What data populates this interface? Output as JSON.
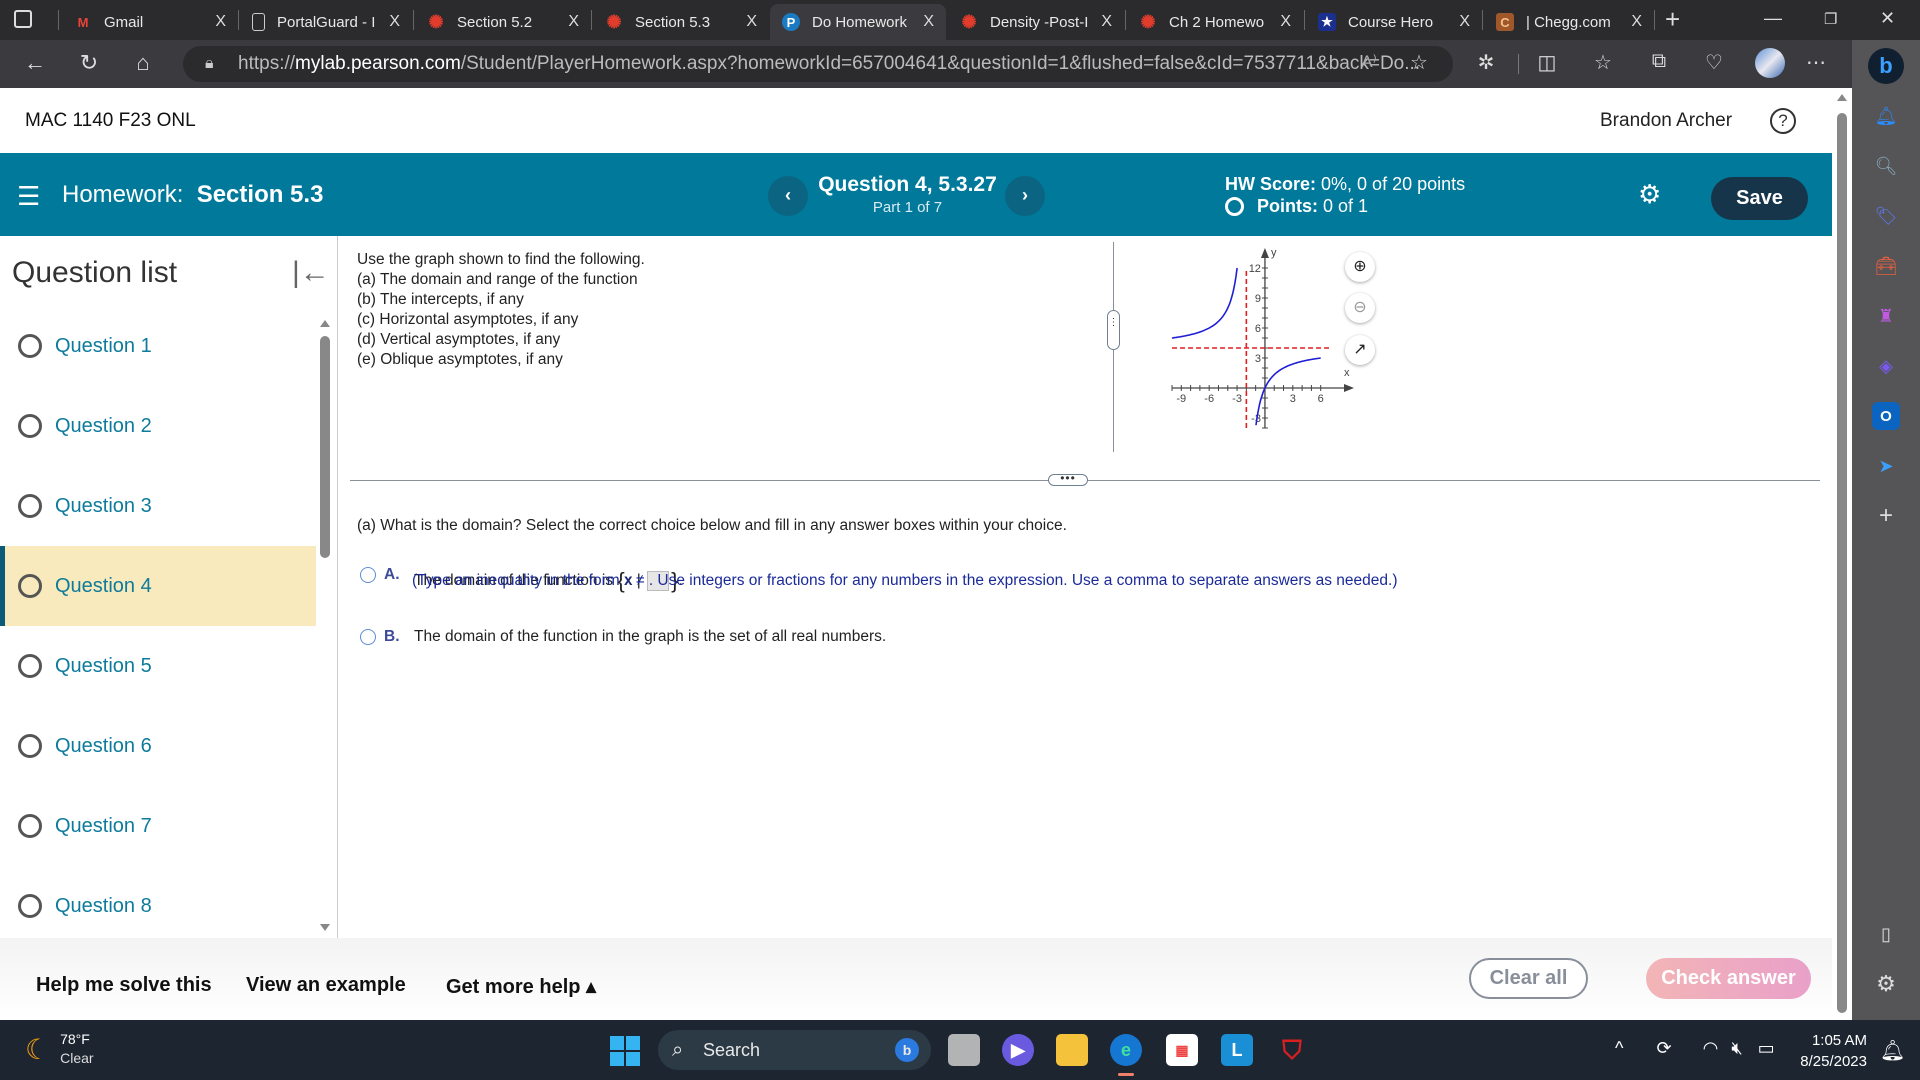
{
  "browser": {
    "tabs": [
      {
        "label": "Gmail",
        "icon": "gmail-icon"
      },
      {
        "label": "PortalGuard - I",
        "icon": "document-icon"
      },
      {
        "label": "Section 5.2",
        "icon": "canvas-icon"
      },
      {
        "label": "Section 5.3",
        "icon": "canvas-icon"
      },
      {
        "label": "Do Homework",
        "icon": "pearson-icon",
        "active": true
      },
      {
        "label": "Density -Post-I",
        "icon": "canvas-icon"
      },
      {
        "label": "Ch 2 Homewo",
        "icon": "canvas-icon"
      },
      {
        "label": "Course Hero",
        "icon": "coursehero-icon"
      },
      {
        "label": "| Chegg.com",
        "icon": "chegg-icon"
      }
    ],
    "close_glyph": "X",
    "new_tab_glyph": "+",
    "url_prefix": "https://",
    "url_domain": "mylab.pearson.com",
    "url_path": "/Student/PlayerHomework.aspx?homeworkId=657004641&questionId=1&flushed=false&cId=7537711&back=Do...",
    "read_aloud": "A))"
  },
  "header": {
    "course": "MAC 1140 F23 ONL",
    "user": "Brandon Archer",
    "help_glyph": "?"
  },
  "hwbar": {
    "homework_label": "Homework:",
    "section": "Section 5.3",
    "question_title": "Question 4, 5.3.27",
    "part": "Part 1 of 7",
    "score_label": "HW Score:",
    "score_value": "0%, 0 of 20 points",
    "points_label": "Points:",
    "points_value": "0 of 1",
    "save": "Save",
    "prev_glyph": "‹",
    "next_glyph": "›"
  },
  "sidebar": {
    "title": "Question list",
    "items": [
      {
        "label": "Question 1"
      },
      {
        "label": "Question 2"
      },
      {
        "label": "Question 3"
      },
      {
        "label": "Question 4",
        "active": true
      },
      {
        "label": "Question 5"
      },
      {
        "label": "Question 6"
      },
      {
        "label": "Question 7"
      },
      {
        "label": "Question 8"
      }
    ]
  },
  "question": {
    "intro": "Use the graph shown to find the following.",
    "parts": [
      "(a)  The domain and range of the function",
      "(b)  The intercepts, if any",
      "(c)  Horizontal asymptotes, if any",
      "(d)  Vertical asymptotes, if any",
      "(e)  Oblique asymptotes, if any"
    ],
    "prompt": "(a)  What is the domain? Select the correct choice below and fill in any answer boxes within your choice.",
    "choices": [
      {
        "letter": "A.",
        "text_before": "The domain of the function is ",
        "set_open": "{",
        "set_var": "x |",
        "set_close": "}",
        "text_after": ".",
        "answer_value": ""
      },
      {
        "letter": "B.",
        "text": "The domain of the function in the graph is the set of all real numbers."
      }
    ],
    "hint": "(Type an inequality in the form x ≠ . Use integers or fractions for any numbers in the expression. Use a comma to separate answers as needed.)"
  },
  "chart_data": {
    "type": "line",
    "title": "",
    "xlabel": "x",
    "ylabel": "y",
    "xlim": [
      -10,
      7
    ],
    "ylim": [
      -4,
      13
    ],
    "x_ticks": [
      -9,
      -6,
      -3,
      3,
      6
    ],
    "y_ticks": [
      -3,
      3,
      6,
      9,
      12
    ],
    "asymptotes": {
      "vertical_x": -2,
      "horizontal_y": 4
    },
    "series": [
      {
        "name": "left-branch",
        "points": [
          [
            -10,
            5.0
          ],
          [
            -8,
            5.33
          ],
          [
            -6,
            6.0
          ],
          [
            -5,
            6.67
          ],
          [
            -4,
            8.0
          ],
          [
            -3.5,
            9.33
          ],
          [
            -3,
            12.0
          ]
        ]
      },
      {
        "name": "right-branch",
        "points": [
          [
            -1.33,
            -4.0
          ],
          [
            -1,
            -2.0
          ],
          [
            -0.5,
            -1.33
          ],
          [
            0,
            0.0
          ],
          [
            1,
            1.33
          ],
          [
            2,
            2.0
          ],
          [
            3,
            2.4
          ],
          [
            4,
            2.67
          ],
          [
            6,
            3.0
          ]
        ]
      }
    ],
    "colors": {
      "curve": "#1f1fd6",
      "asymptote": "#e02020"
    },
    "controls": [
      "zoom-in",
      "zoom-out",
      "open-in-new-window"
    ]
  },
  "helpbar": {
    "help_me": "Help me solve this",
    "example": "View an example",
    "more_help": "Get more help ▴",
    "clear_all": "Clear all",
    "check_answer": "Check answer"
  },
  "taskbar": {
    "temp": "78°F",
    "condition": "Clear",
    "search": "Search",
    "time": "1:05 AM",
    "date": "8/25/2023"
  },
  "colors": {
    "teal": "#00799a",
    "save_bg": "#16354a",
    "active_question_bg": "#f8eabc",
    "link": "#0e7a9c"
  }
}
